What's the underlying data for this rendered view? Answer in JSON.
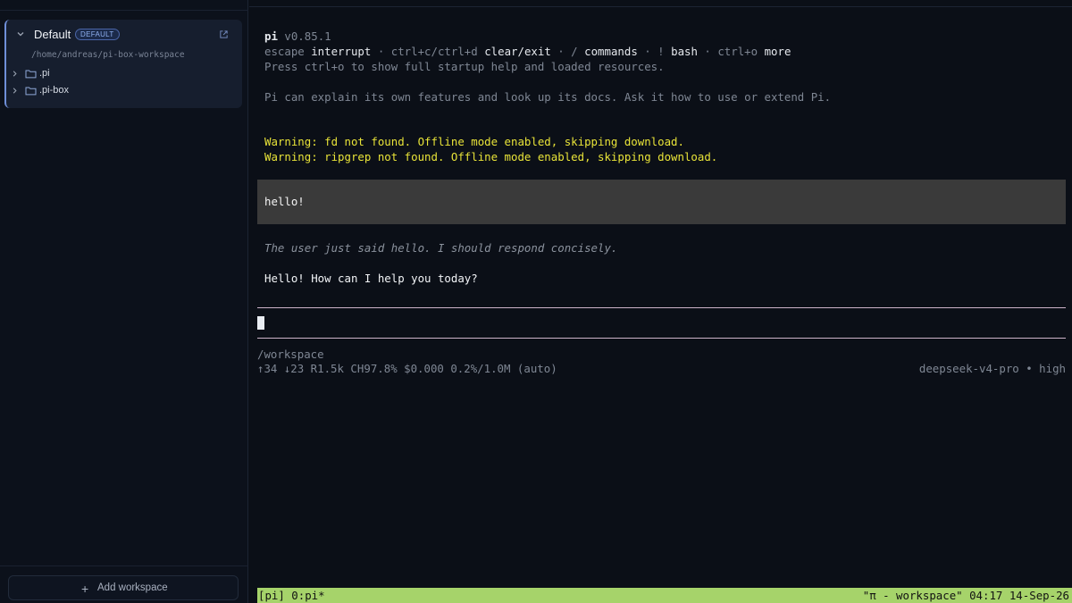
{
  "sidebar": {
    "workspace": {
      "name": "Default",
      "badge": "DEFAULT",
      "path": "/home/andreas/pi-box-workspace",
      "items": [
        {
          "label": ".pi",
          "icon": "folder-icon"
        },
        {
          "label": ".pi-box",
          "icon": "folder-icon"
        }
      ]
    },
    "add_workspace_label": "Add workspace"
  },
  "terminal": {
    "header": {
      "app": "pi",
      "version": "v0.85.1",
      "hint_line": [
        {
          "t": "escape ",
          "k": "dim"
        },
        {
          "t": "interrupt",
          "k": "bright"
        },
        {
          "t": " · ctrl+c/ctrl+d ",
          "k": "dim"
        },
        {
          "t": "clear/exit",
          "k": "bright"
        },
        {
          "t": " · / ",
          "k": "dim"
        },
        {
          "t": "commands",
          "k": "bright"
        },
        {
          "t": " · ! ",
          "k": "dim"
        },
        {
          "t": "bash",
          "k": "bright"
        },
        {
          "t": " · ctrl+o ",
          "k": "dim"
        },
        {
          "t": "more",
          "k": "bright"
        }
      ],
      "startup_hint": "Press ctrl+o to show full startup help and loaded resources.",
      "docs_hint": "Pi can explain its own features and look up its docs. Ask it how to use or extend Pi."
    },
    "warnings": [
      "Warning: fd not found. Offline mode enabled, skipping download.",
      "Warning: ripgrep not found. Offline mode enabled, skipping download."
    ],
    "user_message": "hello!",
    "thinking": "The user just said hello. I should respond concisely.",
    "assistant_reply": "Hello! How can I help you today?",
    "cwd": "/workspace",
    "stats": "↑34 ↓23 R1.5k CH97.8% $0.000 0.2%/1.0M (auto)",
    "model": "deepseek-v4-pro • high",
    "tmux": {
      "left": "[pi] 0:pi*",
      "right": "\"π - workspace\" 04:17 14-Sep-26"
    }
  },
  "colors": {
    "accent": "#6f8fd8",
    "warning": "#e8e338",
    "status_bar": "#a6d36a",
    "user_block": "#3a3a3a"
  }
}
